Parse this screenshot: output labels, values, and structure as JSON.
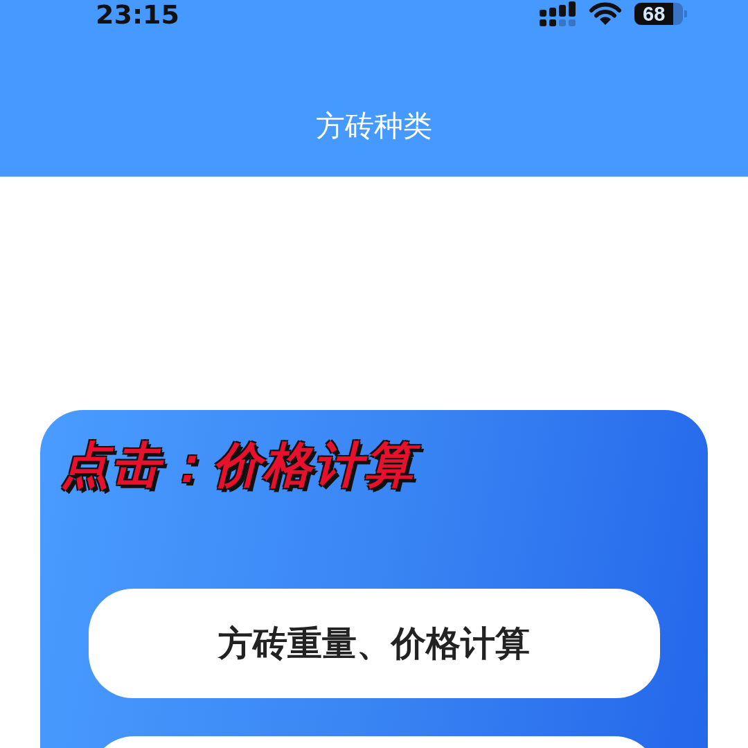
{
  "status_bar": {
    "time": "23:15",
    "battery": "68"
  },
  "header": {
    "title": "方砖种类"
  },
  "annotation": {
    "text": "点击：价格计算"
  },
  "menu": {
    "buttons": [
      {
        "label": "方砖重量、价格计算"
      }
    ]
  }
}
